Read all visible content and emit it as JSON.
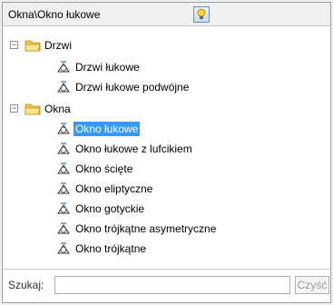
{
  "header": {
    "path": "Okna\\Okno łukowe",
    "button_icon": "lightbulb-icon"
  },
  "tree": {
    "groups": [
      {
        "label": "Drzwi",
        "expander": "−",
        "items": [
          "Drzwi łukowe",
          "Drzwi łukowe podwójne"
        ]
      },
      {
        "label": "Okna",
        "expander": "−",
        "items": [
          "Okno łukowe",
          "Okno łukowe z lufcikiem",
          "Okno ścięte",
          "Okno eliptyczne",
          "Okno gotyckie",
          "Okno trójkątne asymetryczne",
          "Okno trójkątne"
        ]
      }
    ],
    "selected": "Okno łukowe"
  },
  "search": {
    "label": "Szukaj:",
    "value": "",
    "placeholder": "",
    "clear_label": "Czyść"
  },
  "colors": {
    "selection": "#3399ff",
    "folder": "#f3c64d"
  }
}
